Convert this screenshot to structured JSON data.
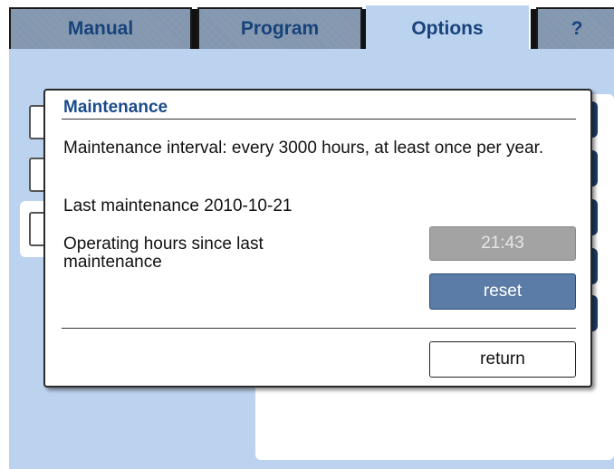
{
  "tabs": [
    {
      "label": "Manual",
      "active": false
    },
    {
      "label": "Program",
      "active": false
    },
    {
      "label": "Options",
      "active": true
    },
    {
      "label": "?",
      "active": false
    }
  ],
  "dialog": {
    "title": "Maintenance",
    "interval_text": "Maintenance interval: every 3000 hours, at least once per year.",
    "last_maintenance": "Last maintenance 2010-10-21",
    "hours_label": "Operating hours since last maintenance",
    "hours_value": "21:43",
    "reset_label": "reset",
    "return_label": "return"
  },
  "colors": {
    "background_area": "#bcd3ef",
    "tab_text": "#17427a",
    "title_text": "#1a4a8a",
    "reset_button": "#5b7ca6",
    "hours_box": "#a3a3a3"
  }
}
